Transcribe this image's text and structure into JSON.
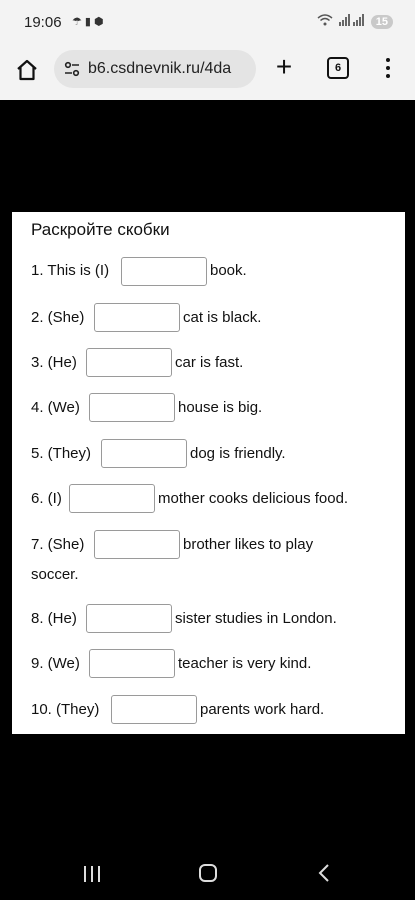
{
  "status_bar": {
    "time": "19:06",
    "battery": "15",
    "notification_icons": [
      "umbrella-icon",
      "battery-saver-icon",
      "cube-icon"
    ]
  },
  "browser": {
    "url": "b6.csdnevnik.ru/4da",
    "tab_count": "6"
  },
  "exercise": {
    "title": "Раскройте скобки",
    "items": [
      {
        "prefix": "1. This is (I)",
        "suffix": "book."
      },
      {
        "prefix": "2. (She)",
        "suffix": "cat is black."
      },
      {
        "prefix": "3. (He)",
        "suffix": "car is fast."
      },
      {
        "prefix": "4. (We)",
        "suffix": "house is big."
      },
      {
        "prefix": "5. (They)",
        "suffix": "dog is friendly."
      },
      {
        "prefix": "6. (I)",
        "suffix": "mother cooks delicious food."
      },
      {
        "prefix": "7. (She)",
        "suffix": "brother likes to play",
        "suffix_line2": "soccer."
      },
      {
        "prefix": "8. (He)",
        "suffix": "sister studies in London."
      },
      {
        "prefix": "9. (We)",
        "suffix": "teacher is very kind."
      },
      {
        "prefix": "10. (They)",
        "suffix": "parents work hard."
      }
    ]
  }
}
